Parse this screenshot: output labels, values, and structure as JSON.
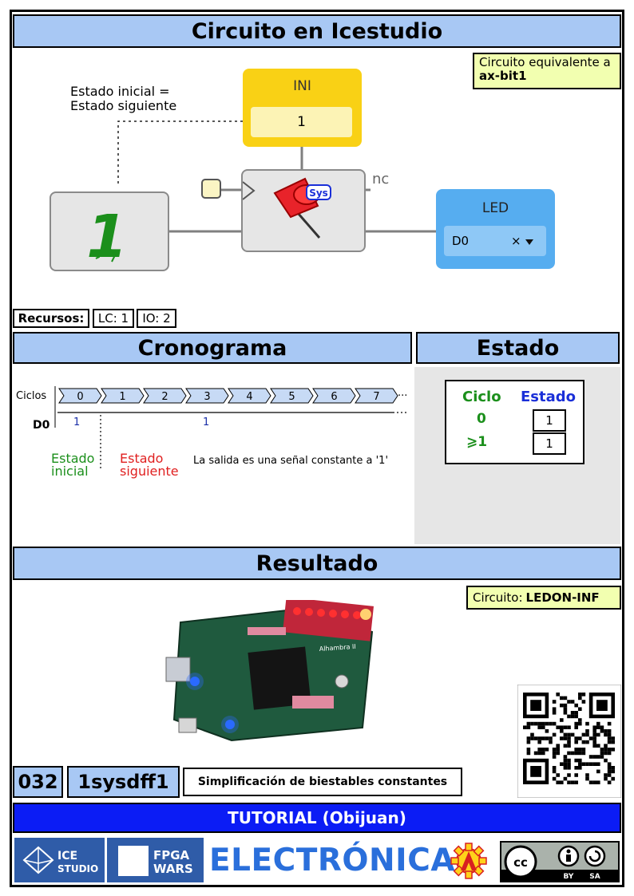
{
  "circuit": {
    "title": "Circuito en Icestudio",
    "equiv_note": "Circuito equivalente a",
    "equiv_bold": "ax-bit1",
    "state_note_line1": "Estado inicial =",
    "state_note_line2": "Estado siguiente",
    "ini_block_title": "INI",
    "ini_value": "1",
    "const_value": "1",
    "sys_badge": "Sys",
    "nc_label": "nc",
    "led_block_title": "LED",
    "led_pin": "D0",
    "led_close": "×",
    "resources_label": "Recursos:",
    "res_lc": "LC: 1",
    "res_io": "IO: 2"
  },
  "chrono": {
    "title": "Cronograma",
    "cycles_label": "Ciclos",
    "cycles": [
      "0",
      "1",
      "2",
      "3",
      "4",
      "5",
      "6",
      "7"
    ],
    "ellipsis": "···",
    "signal_label": "D0",
    "d0_marks": [
      "1",
      "1"
    ],
    "initial_line1": "Estado",
    "initial_line2": "inicial",
    "next_line1": "Estado",
    "next_line2": "siguiente",
    "description": "La salida es una señal constante a '1'"
  },
  "state": {
    "title": "Estado",
    "col_cycle": "Ciclo",
    "col_state": "Estado",
    "rows": [
      {
        "cycle": "0",
        "state": "1"
      },
      {
        "cycle": "⩾1",
        "state": "1"
      }
    ]
  },
  "result": {
    "title": "Resultado",
    "circuit_label": "Circuito:",
    "circuit_name": "LEDON-INF",
    "board_name": "Alhambra II"
  },
  "footer": {
    "number": "032",
    "code": "1sysdff1",
    "subtitle": "Simplificación de biestables constantes",
    "tutorial": "TUTORIAL (Obijuan)",
    "ice_line1": "ICE",
    "ice_line2": "STUDIO",
    "fpga_line1": "FPGA",
    "fpga_line2": "WARS",
    "electronica": "ELECTRÓNICA",
    "cc_by": "BY",
    "cc_sa": "SA"
  },
  "colors": {
    "header_blue": "#a8c8f4",
    "note_yellow": "#f2ffb0",
    "ini_yellow": "#f9d115",
    "led_blue": "#56adf0",
    "green": "#1b8f1b",
    "red": "#e02020",
    "tutorial_blue": "#0b1cf5",
    "electronica_blue": "#2a6fdb"
  }
}
